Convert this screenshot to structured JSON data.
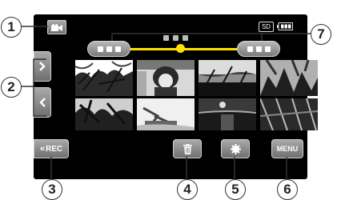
{
  "status": {
    "storage_label": "SD"
  },
  "buttons": {
    "rec_label": "REC",
    "menu_label": "MENU"
  },
  "callouts": [
    "1",
    "2",
    "3",
    "4",
    "5",
    "6",
    "7"
  ],
  "icons": {
    "mode": "video-camera-icon",
    "battery": "battery-icon",
    "next": "chevron-right-icon",
    "prev": "chevron-left-icon",
    "back": "double-chevron-left-icon",
    "delete": "trash-icon",
    "play": "gear-icon"
  },
  "colors": {
    "slider_track": "#ffe100",
    "button_grey": "#8a8a8a",
    "screen": "#000000"
  }
}
